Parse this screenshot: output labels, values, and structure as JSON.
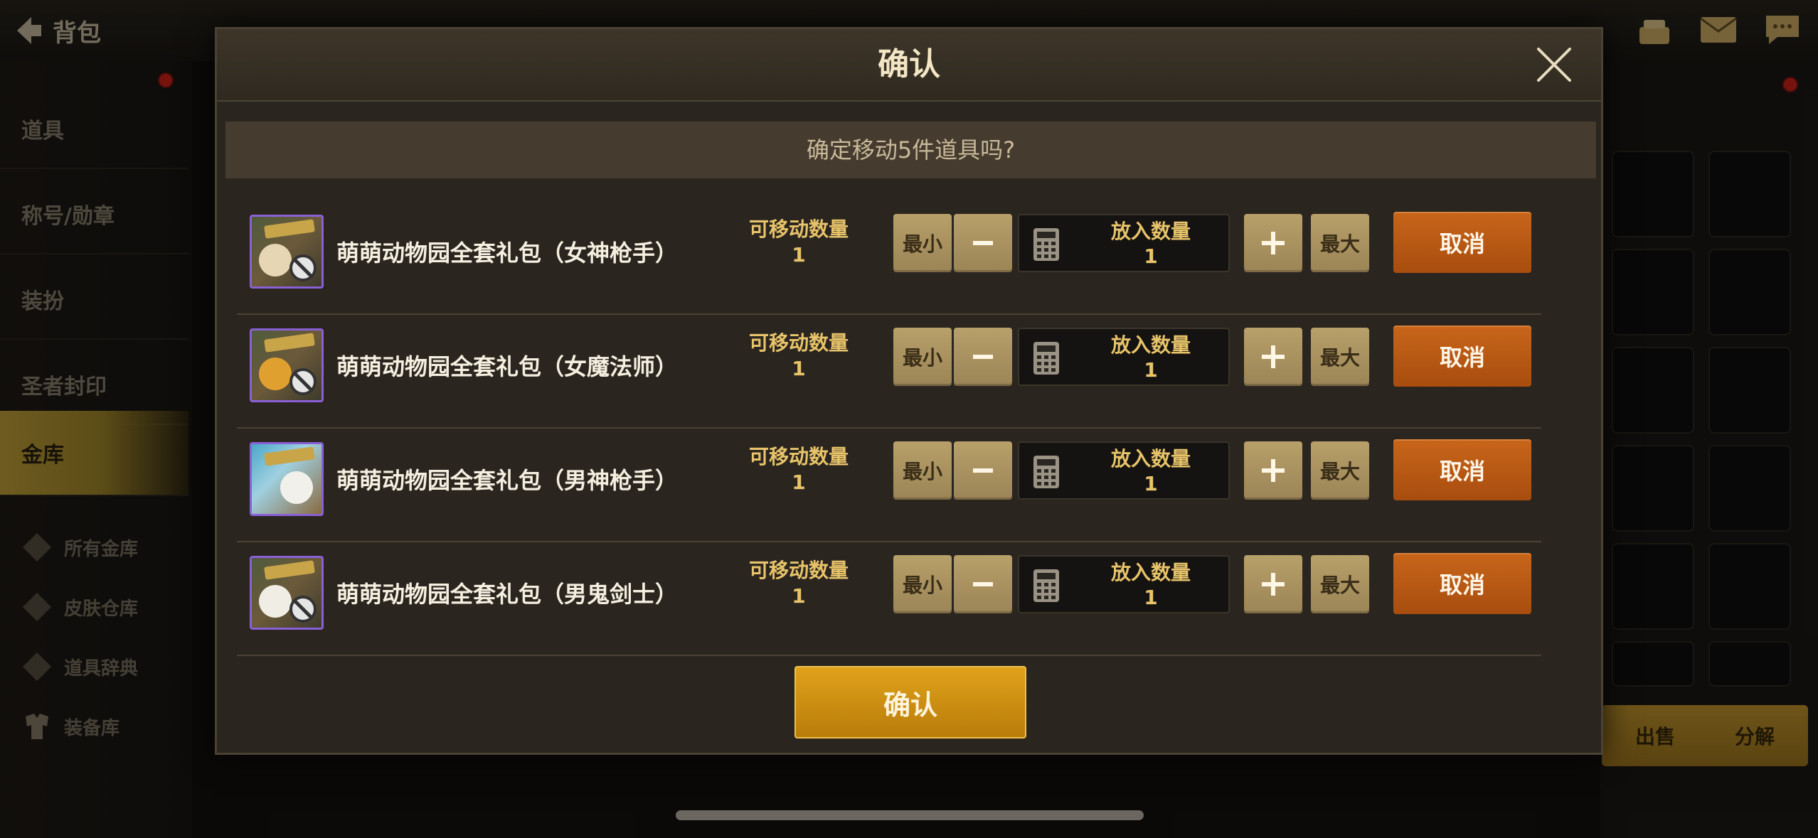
{
  "background": {
    "back_label": "背包",
    "sidebar_tabs": [
      "道具",
      "称号/勋章",
      "装扮",
      "圣者封印",
      "金库"
    ],
    "sidebar_sub": [
      "所有金库",
      "皮肤仓库",
      "道具辞典",
      "装备库"
    ],
    "bottom_buttons": [
      "出售",
      "分解"
    ]
  },
  "modal": {
    "title": "确认",
    "question": "确定移动5件道具吗?",
    "movable_label": "可移动数量",
    "put_label": "放入数量",
    "min_label": "最小",
    "max_label": "最大",
    "cancel_label": "取消",
    "confirm_label": "确认",
    "items": [
      {
        "name": "萌萌动物园全套礼包（女神枪手）",
        "movable": "1",
        "put": "1"
      },
      {
        "name": "萌萌动物园全套礼包（女魔法师）",
        "movable": "1",
        "put": "1"
      },
      {
        "name": "萌萌动物园全套礼包（男神枪手）",
        "movable": "1",
        "put": "1"
      },
      {
        "name": "萌萌动物园全套礼包（男鬼剑士）",
        "movable": "1",
        "put": "1"
      }
    ]
  },
  "colors": {
    "accent_gold": "#e0a21a",
    "cancel_orange": "#c8651a",
    "item_border_purple": "#8a60d6",
    "label_gold": "#e7c36a"
  },
  "icons": [
    "back-arrow-icon",
    "close-icon",
    "calculator-icon",
    "minus-icon",
    "plus-icon",
    "ban-icon"
  ]
}
